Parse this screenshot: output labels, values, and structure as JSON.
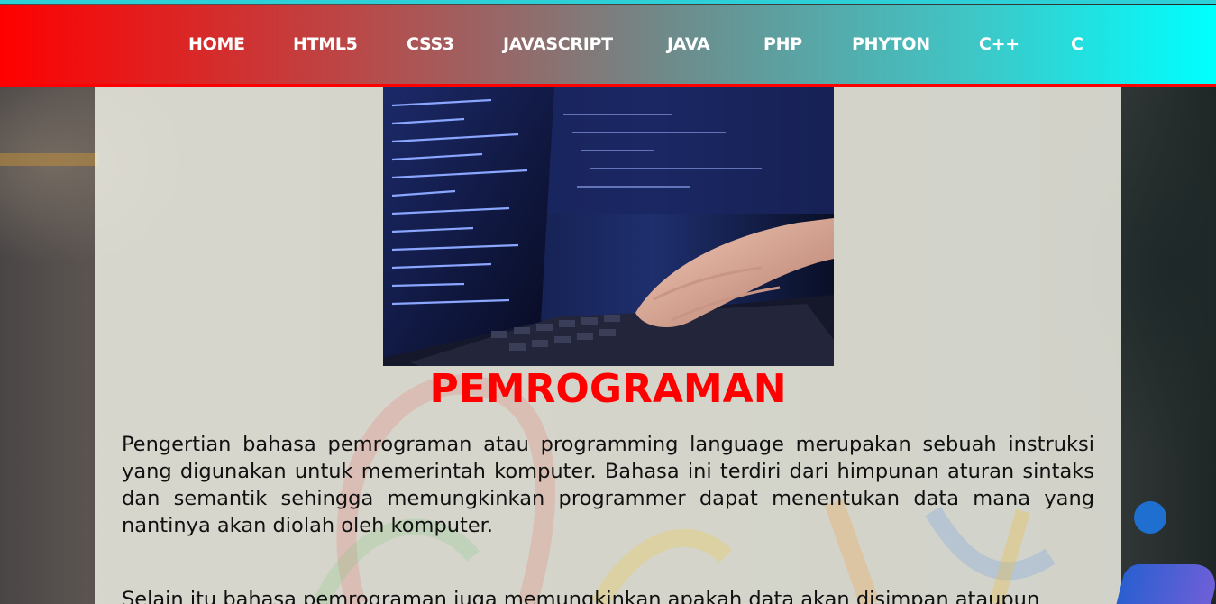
{
  "nav": {
    "items": [
      {
        "label": "HOME"
      },
      {
        "label": "HTML5"
      },
      {
        "label": "CSS3"
      },
      {
        "label": "JAVASCRIPT"
      },
      {
        "label": "JAVA"
      },
      {
        "label": "PHP"
      },
      {
        "label": "PHYTON"
      },
      {
        "label": "C++"
      },
      {
        "label": "C"
      }
    ]
  },
  "main": {
    "hero_image": "laptop-coding-photo",
    "title": "PEMROGRAMAN",
    "paragraphs": [
      "Pengertian bahasa pemrograman atau programming language merupakan sebuah instruksi yang digunakan untuk memerintah komputer. Bahasa ini terdiri dari himpunan aturan sintaks dan semantik sehingga memungkinkan programmer dapat menentukan data mana yang nantinya akan diolah oleh komputer.",
      "Selain itu bahasa pemrograman juga memungkinkan apakah data akan disimpan ataupun"
    ]
  },
  "colors": {
    "title": "#ff0000",
    "nav_gradient_start": "#ff0000",
    "nav_gradient_end": "#00ffff",
    "nav_text": "#ffffff"
  }
}
